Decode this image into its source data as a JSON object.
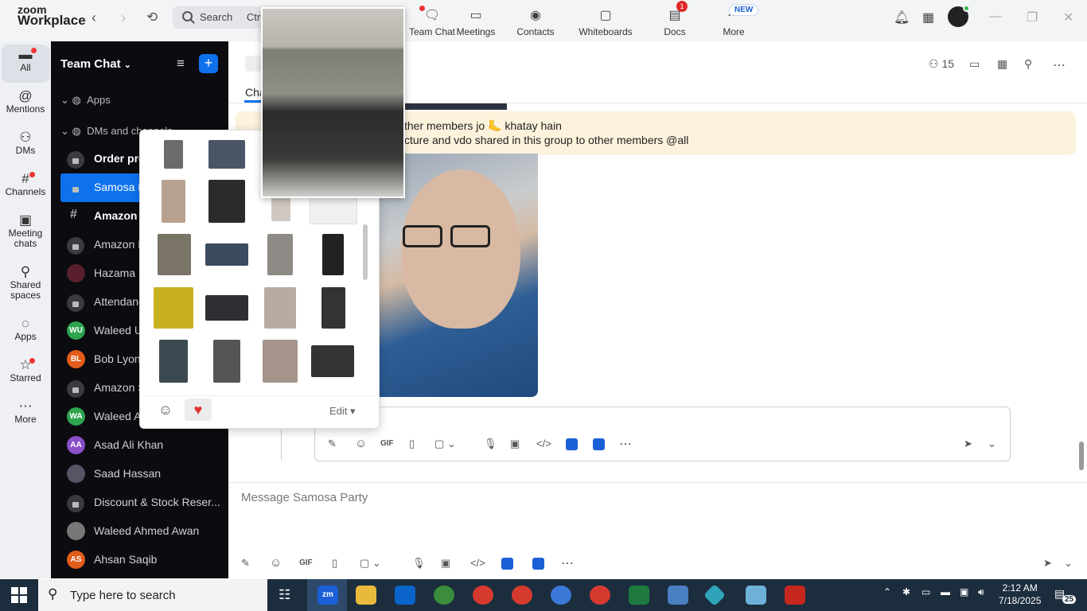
{
  "app": {
    "logo_line1": "zoom",
    "logo_line2": "Workplace"
  },
  "search": {
    "label": "Search",
    "shortcut": "Ctrl"
  },
  "top_nav": [
    {
      "label": "Team Chat",
      "icon": "chat-bubble-icon"
    },
    {
      "label": "Meetings",
      "icon": "video-camera-icon"
    },
    {
      "label": "Contacts",
      "icon": "contact-card-icon"
    },
    {
      "label": "Whiteboards",
      "icon": "whiteboard-icon"
    },
    {
      "label": "Docs",
      "icon": "document-icon",
      "badge": "1"
    },
    {
      "label": "More",
      "icon": "more-dots-icon",
      "badge": "NEW"
    }
  ],
  "left_rail": [
    {
      "label": "All",
      "icon": "chat-icon"
    },
    {
      "label": "Mentions",
      "icon": "at-icon"
    },
    {
      "label": "DMs",
      "icon": "people-icon"
    },
    {
      "label": "Channels",
      "icon": "hash-icon"
    },
    {
      "label": "Meeting chats",
      "icon": "calendar-icon"
    },
    {
      "label": "Shared spaces",
      "icon": "shared-icon"
    },
    {
      "label": "Apps",
      "icon": "apps-icon"
    },
    {
      "label": "Starred",
      "icon": "star-icon"
    },
    {
      "label": "More",
      "icon": "more-icon"
    }
  ],
  "sidebar": {
    "title": "Team Chat",
    "apps_label": "Apps",
    "dms_label": "DMs and channels",
    "items": [
      {
        "label": "Order pro",
        "kind": "lock"
      },
      {
        "label": "Samosa P",
        "kind": "lock"
      },
      {
        "label": "Amazon C",
        "kind": "hash"
      },
      {
        "label": "Amazon P",
        "kind": "lock"
      },
      {
        "label": "Hazama N",
        "kind": "avatar"
      },
      {
        "label": "Attendanc",
        "kind": "lock"
      },
      {
        "label": "Waleed U",
        "kind": "avatar",
        "initials": "WU"
      },
      {
        "label": "Bob Lyon",
        "kind": "avatar",
        "initials": "BL"
      },
      {
        "label": "Amazon S",
        "kind": "lock"
      },
      {
        "label": "Waleed A",
        "kind": "avatar",
        "initials": "WA"
      },
      {
        "label": "Asad Ali Khan",
        "kind": "avatar",
        "initials": "AA"
      },
      {
        "label": "Saad Hassan",
        "kind": "avatar"
      },
      {
        "label": "Discount & Stock Reser...",
        "kind": "lock"
      },
      {
        "label": "Waleed Ahmed Awan",
        "kind": "avatar"
      },
      {
        "label": "Ahsan Saqib",
        "kind": "avatar",
        "initials": "AS"
      }
    ]
  },
  "header": {
    "members": "15",
    "tab_prefix": "Cha"
  },
  "banner": {
    "line1": "ther members jo 🦶 khatay hain",
    "line2": "cture and vdo shared in this group to other members @all"
  },
  "composer": {
    "placeholder": "Message Samosa Party",
    "gif": "GIF"
  },
  "sticker_popup": {
    "edit_label": "Edit ▾"
  },
  "taskbar": {
    "search": "Type here to search",
    "time": "2:12 AM",
    "date": "7/18/2025",
    "notif": "25"
  },
  "colors": {
    "accent": "#0e72ed",
    "sidebar_bg": "#0b0b10",
    "banner_bg": "#fdf3dd"
  }
}
